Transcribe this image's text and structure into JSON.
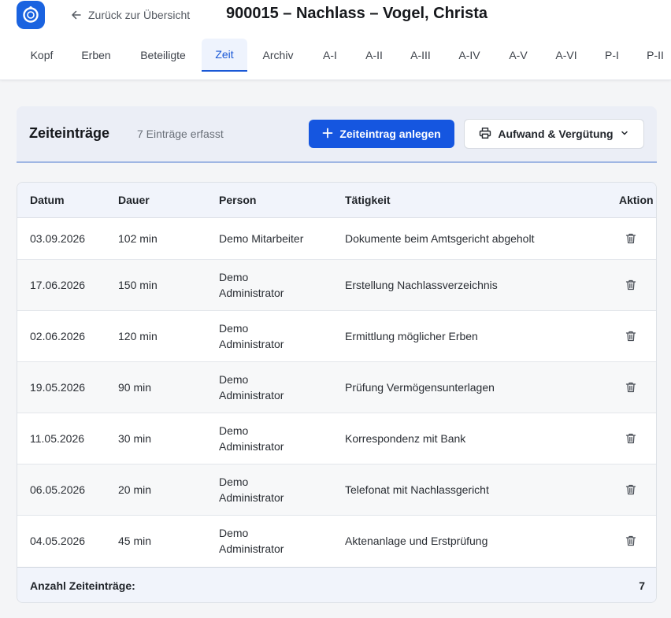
{
  "header": {
    "back_label": "Zurück zur Übersicht",
    "title": "900015 – Nachlass – Vogel, Christa",
    "logo_icon": "app-logo-icon",
    "accent_color": "#1556e0"
  },
  "tabs": [
    {
      "label": "Kopf"
    },
    {
      "label": "Erben"
    },
    {
      "label": "Beteiligte"
    },
    {
      "label": "Zeit",
      "active": true
    },
    {
      "label": "Archiv"
    },
    {
      "label": "A-I"
    },
    {
      "label": "A-II"
    },
    {
      "label": "A-III"
    },
    {
      "label": "A-IV"
    },
    {
      "label": "A-V"
    },
    {
      "label": "A-VI"
    },
    {
      "label": "P-I"
    },
    {
      "label": "P-II"
    }
  ],
  "card": {
    "title": "Zeiteinträge",
    "count_text": "7 Einträge erfasst",
    "add_button": "Zeiteintrag anlegen",
    "expense_button": "Aufwand & Vergütung"
  },
  "table": {
    "columns": [
      "Datum",
      "Dauer",
      "Person",
      "Tätigkeit",
      "Aktion"
    ],
    "rows": [
      {
        "datum": "03.09.2026",
        "dauer": "102 min",
        "person": "Demo Mitarbeiter",
        "taetigkeit": "Dokumente beim Amtsgericht abgeholt"
      },
      {
        "datum": "17.06.2026",
        "dauer": "150 min",
        "person": "Demo Administrator",
        "taetigkeit": "Erstellung Nachlassverzeichnis"
      },
      {
        "datum": "02.06.2026",
        "dauer": "120 min",
        "person": "Demo Administrator",
        "taetigkeit": "Ermittlung möglicher Erben"
      },
      {
        "datum": "19.05.2026",
        "dauer": "90 min",
        "person": "Demo Administrator",
        "taetigkeit": "Prüfung Vermögensunterlagen"
      },
      {
        "datum": "11.05.2026",
        "dauer": "30 min",
        "person": "Demo Administrator",
        "taetigkeit": "Korrespondenz mit Bank"
      },
      {
        "datum": "06.05.2026",
        "dauer": "20 min",
        "person": "Demo Administrator",
        "taetigkeit": "Telefonat mit Nachlassgericht"
      },
      {
        "datum": "04.05.2026",
        "dauer": "45 min",
        "person": "Demo Administrator",
        "taetigkeit": "Aktenanlage und Erstprüfung"
      }
    ],
    "footer_label": "Anzahl Zeiteinträge:",
    "footer_value": "7"
  }
}
